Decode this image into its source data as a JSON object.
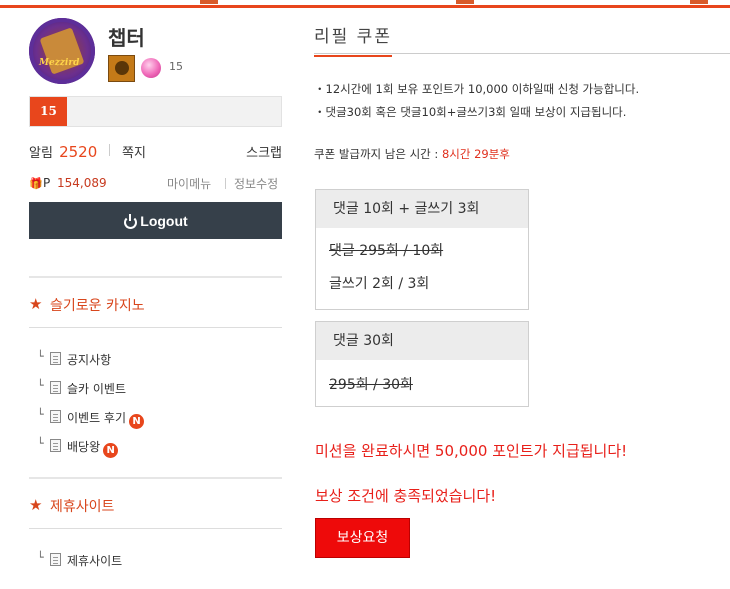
{
  "profile": {
    "nickname": "챕터",
    "avatar_caption": "Mezzird",
    "level": "15",
    "level_badge": "15",
    "alarm_label": "알림",
    "alarm_count": "2520",
    "memo_label": "쪽지",
    "scrap_label": "스크랩",
    "point_label": "P",
    "points": "154,089",
    "mymenu_label": "마이메뉴",
    "edit_label": "정보수정",
    "logout_label": "Logout"
  },
  "sections": [
    {
      "title": "슬기로운 카지노",
      "items": [
        {
          "label": "공지사항",
          "is_new": false
        },
        {
          "label": "슬카 이벤트",
          "is_new": false
        },
        {
          "label": "이벤트 후기",
          "is_new": true
        },
        {
          "label": "배당왕",
          "is_new": true
        }
      ]
    },
    {
      "title": "제휴사이트",
      "items": [
        {
          "label": "제휴사이트",
          "is_new": false
        }
      ]
    }
  ],
  "new_badge": "N",
  "main": {
    "title": "리필 쿠폰",
    "notes": [
      "・12시간에 1회 보유 포인트가 10,000 이하일때 신청 가능합니다.",
      "・댓글30회 혹은 댓글10회+글쓰기3회 일때 보상이 지급됩니다."
    ],
    "timer_label": "쿠폰 발급까지 남은 시간 : ",
    "timer_value": "8시간 29분후",
    "box1": {
      "header": "댓글 10회 + 글쓰기 3회",
      "line1": "댓글 295회 / 10회",
      "line2": "글쓰기 2회 / 3회"
    },
    "box2": {
      "header": "댓글 30회",
      "line1": "295회 / 30회"
    },
    "mission_text": "미션을 완료하시면 50,000 포인트가 지급됩니다!",
    "done_text": "보상 조건에 충족되었습니다!",
    "request_button": "보상요청"
  },
  "colors": {
    "accent": "#e8461c",
    "alert_red": "#e8201a",
    "button_red": "#ee0a0a",
    "logout_bg": "#36404a"
  }
}
